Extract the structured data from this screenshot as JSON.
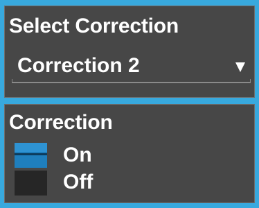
{
  "colors": {
    "frame_border": "#38a9de",
    "panel_background": "#474747",
    "toggle_active": "#1f7fbd",
    "toggle_inactive": "#262626",
    "text": "#ffffff"
  },
  "select_correction": {
    "title": "Select Correction",
    "selected_value": "Correction 2",
    "arrow_icon": "dropdown-triangle-icon"
  },
  "correction_toggle": {
    "title": "Correction",
    "on_label": "On",
    "off_label": "Off",
    "state": "On"
  }
}
